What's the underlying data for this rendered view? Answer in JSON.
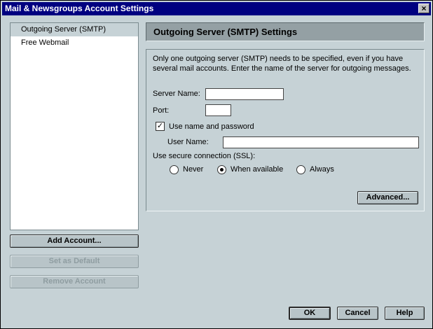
{
  "window": {
    "title": "Mail & Newsgroups Account Settings",
    "close_glyph": "×"
  },
  "accounts": [
    {
      "label": "Outgoing Server (SMTP)",
      "selected": true
    },
    {
      "label": "Free Webmail",
      "selected": false
    }
  ],
  "account_buttons": {
    "add": "Add Account...",
    "set_default": "Set as Default",
    "remove": "Remove Account"
  },
  "panel": {
    "title": "Outgoing Server (SMTP) Settings",
    "description": "Only one outgoing server (SMTP) needs to be specified, even if you have several mail accounts. Enter the name of the server for outgoing messages.",
    "server_name_label": "Server Name:",
    "server_name_value": "",
    "port_label": "Port:",
    "port_value": "",
    "use_auth_label": "Use name and password",
    "use_auth_checked": true,
    "check_glyph": "✓",
    "user_name_label": "User Name:",
    "user_name_value": "",
    "ssl_label": "Use secure connection (SSL):",
    "ssl_options": [
      {
        "label": "Never",
        "selected": false
      },
      {
        "label": "When available",
        "selected": true
      },
      {
        "label": "Always",
        "selected": false
      }
    ],
    "advanced_button": "Advanced..."
  },
  "footer": {
    "ok": "OK",
    "cancel": "Cancel",
    "help": "Help"
  }
}
